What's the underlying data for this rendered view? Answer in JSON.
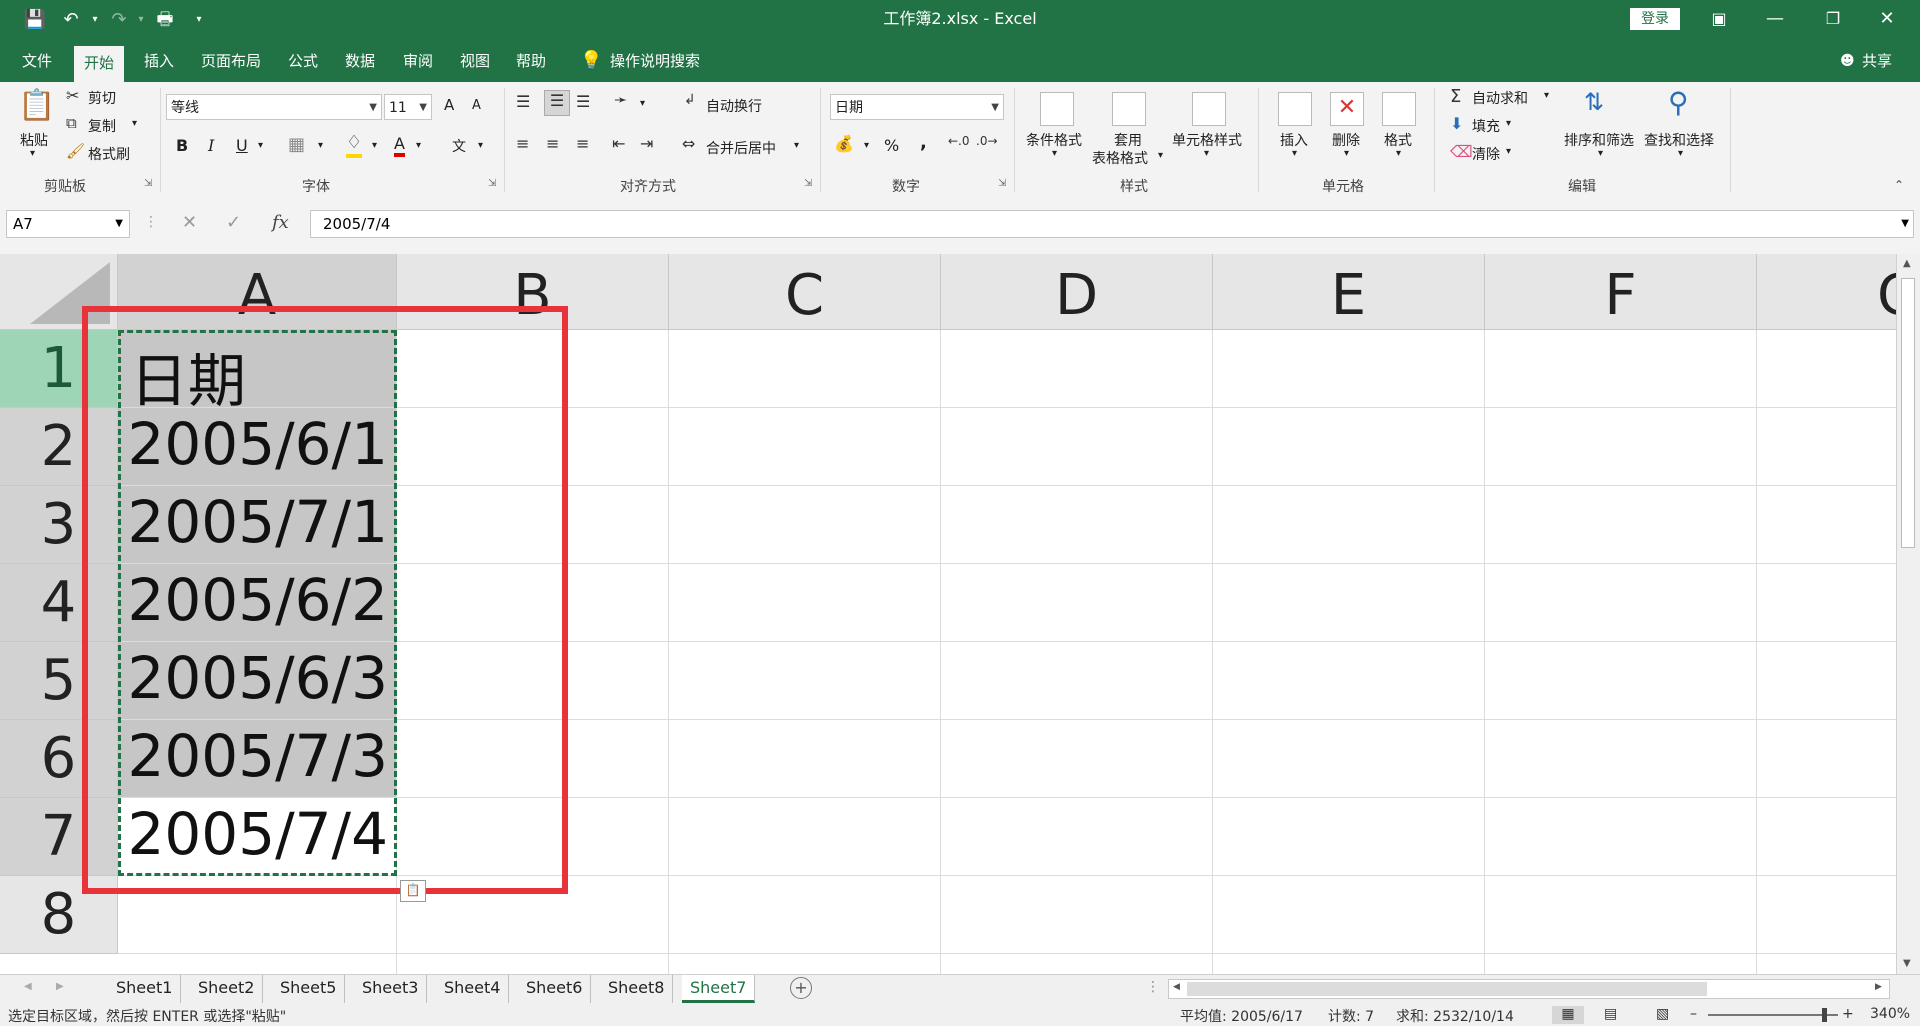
{
  "title": "工作簿2.xlsx  -  Excel",
  "login_label": "登录",
  "share_label": "共享",
  "tabs": [
    "文件",
    "开始",
    "插入",
    "页面布局",
    "公式",
    "数据",
    "审阅",
    "视图",
    "帮助"
  ],
  "tell_me": "操作说明搜索",
  "clipboard": {
    "paste": "粘贴",
    "cut": "剪切",
    "copy": "复制",
    "format_painter": "格式刷",
    "label": "剪贴板"
  },
  "font": {
    "name": "等线",
    "size": "11",
    "bold": "B",
    "italic": "I",
    "underline": "U",
    "label": "字体",
    "grow": "A",
    "shrink": "A",
    "text_color_glyph": "A",
    "phonetic": "文"
  },
  "alignment": {
    "wrap": "自动换行",
    "merge": "合并后居中",
    "label": "对齐方式"
  },
  "number": {
    "format": "日期",
    "percent": "%",
    "comma": ",",
    "label": "数字"
  },
  "styles": {
    "conditional": "条件格式",
    "table_line1": "套用",
    "table_line2": "表格格式",
    "cell_styles": "单元格样式",
    "label": "样式"
  },
  "cells": {
    "insert": "插入",
    "delete": "删除",
    "format": "格式",
    "label": "单元格"
  },
  "editing": {
    "autosum": "自动求和",
    "fill": "填充",
    "clear": "清除",
    "sort": "排序和筛选",
    "find": "查找和选择",
    "label": "编辑"
  },
  "formula_bar": {
    "name_box": "A7",
    "value": "2005/7/4",
    "fx": "fx"
  },
  "columns": [
    "A",
    "B",
    "C",
    "D",
    "E",
    "F",
    "C"
  ],
  "rows": [
    "1",
    "2",
    "3",
    "4",
    "5",
    "6",
    "7",
    "8"
  ],
  "cells_a": [
    "日期",
    "2005/6/1",
    "2005/7/1",
    "2005/6/2",
    "2005/6/3",
    "2005/7/3",
    "2005/7/4"
  ],
  "sheets": [
    "Sheet1",
    "Sheet2",
    "Sheet5",
    "Sheet3",
    "Sheet4",
    "Sheet6",
    "Sheet8",
    "Sheet7"
  ],
  "status": {
    "message": "选定目标区域，然后按 ENTER 或选择\"粘贴\"",
    "average": "平均值: 2005/6/17",
    "count": "计数: 7",
    "sum": "求和: 2532/10/14",
    "zoom": "340%"
  },
  "colors": {
    "excel_green": "#217346",
    "highlight_red": "#e8333a",
    "selected_fill": "#c6c6c6"
  }
}
